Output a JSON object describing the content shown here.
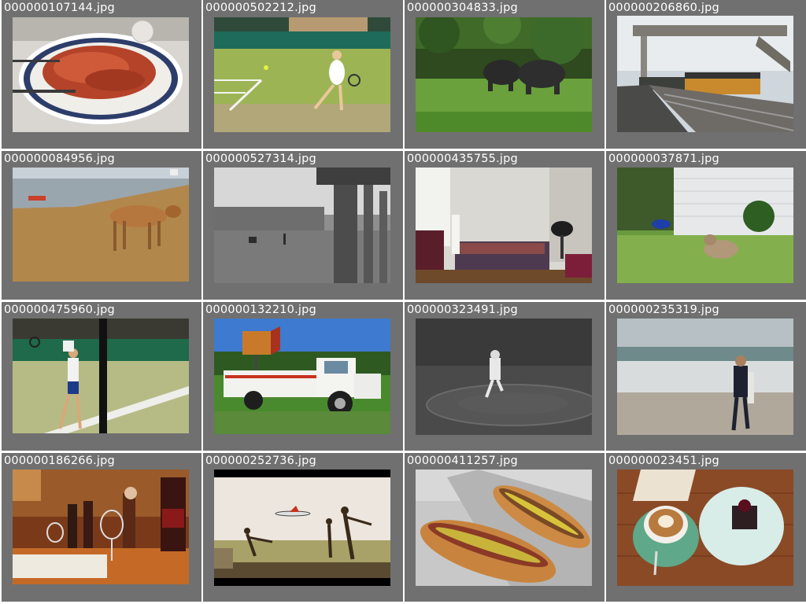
{
  "gallery": {
    "items": [
      {
        "filename": "000000107144.jpg",
        "subject": "plate of prosciutto"
      },
      {
        "filename": "000000502212.jpg",
        "subject": "tennis player on grass court"
      },
      {
        "filename": "000000304833.jpg",
        "subject": "elephants in forest"
      },
      {
        "filename": "000000206860.jpg",
        "subject": "train at station platform"
      },
      {
        "filename": "000000084956.jpg",
        "subject": "cow on beach"
      },
      {
        "filename": "000000527314.jpg",
        "subject": "old photo of town square"
      },
      {
        "filename": "000000435755.jpg",
        "subject": "living room with sofa"
      },
      {
        "filename": "000000037871.jpg",
        "subject": "dog running on lawn"
      },
      {
        "filename": "000000475960.jpg",
        "subject": "tennis players on court"
      },
      {
        "filename": "000000132210.jpg",
        "subject": "old white truck with sign"
      },
      {
        "filename": "000000323491.jpg",
        "subject": "baseball pitcher on mound"
      },
      {
        "filename": "000000235319.jpg",
        "subject": "person with surfboard on beach"
      },
      {
        "filename": "000000186266.jpg",
        "subject": "wine bottles and glasses"
      },
      {
        "filename": "000000252736.jpg",
        "subject": "statues and airplane"
      },
      {
        "filename": "000000411257.jpg",
        "subject": "hot dogs in foil"
      },
      {
        "filename": "000000023451.jpg",
        "subject": "coffee and dessert on table"
      }
    ]
  },
  "colors": {
    "cell_background": "#707070",
    "label_text": "#ffffff",
    "page_background": "#ffffff"
  }
}
